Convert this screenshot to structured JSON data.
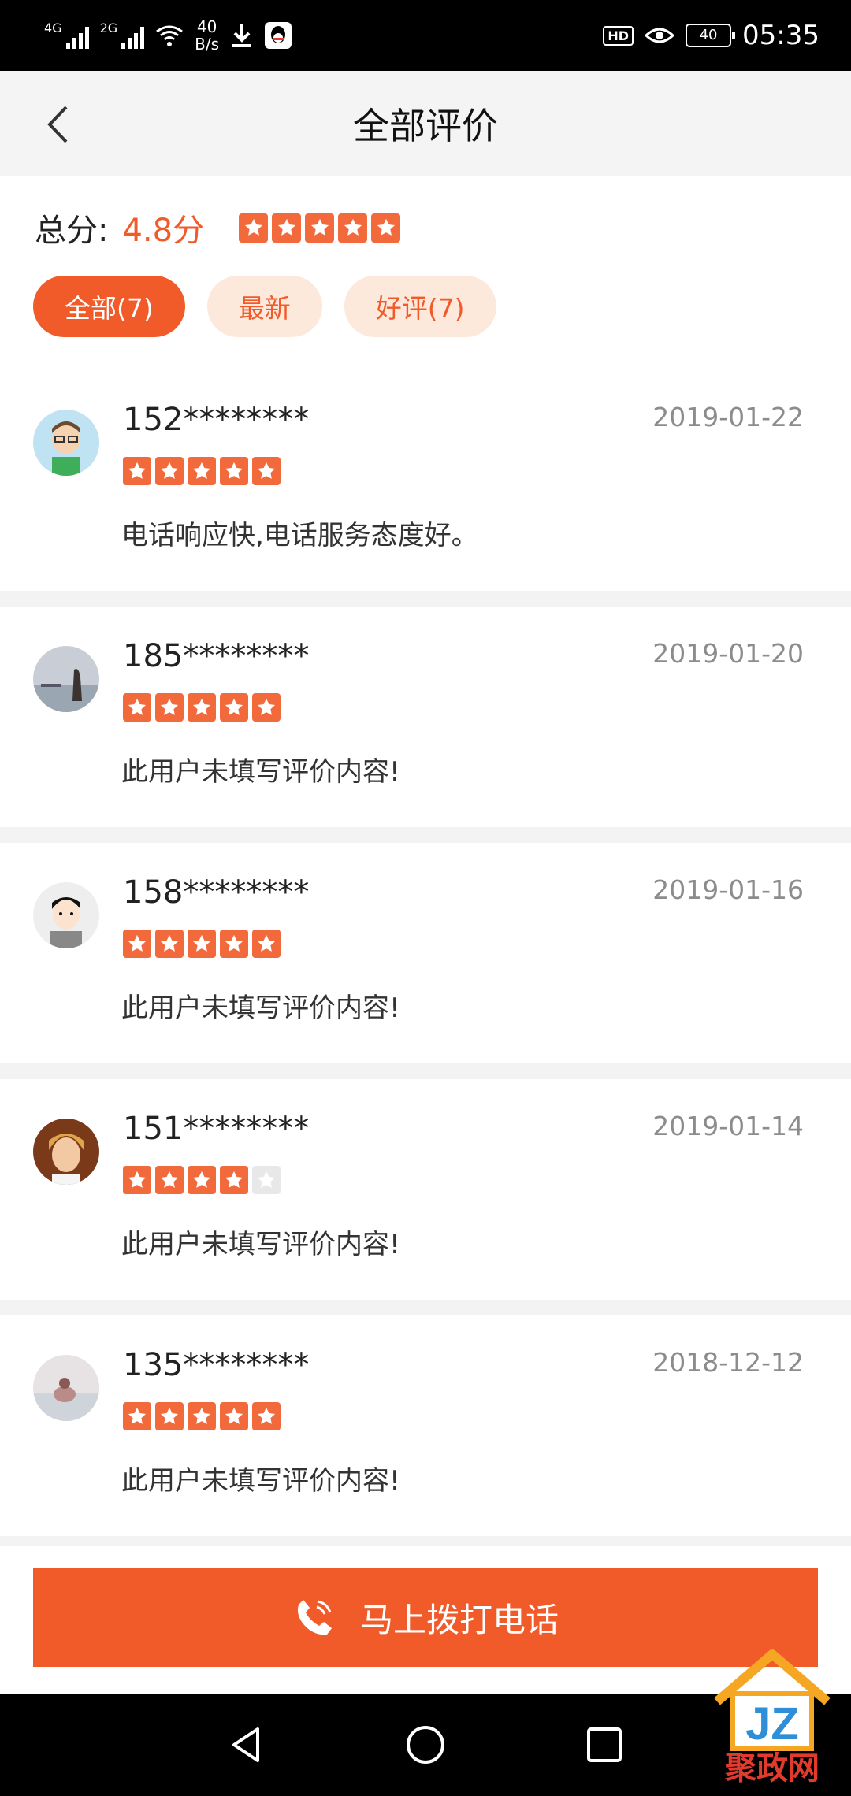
{
  "status_bar": {
    "net1": "4G",
    "net2": "2G",
    "speed_value": "40",
    "speed_unit": "B/s",
    "hd": "HD",
    "battery": "40",
    "time": "05:35"
  },
  "header": {
    "title": "全部评价"
  },
  "score": {
    "label": "总分:",
    "value": "4.8分",
    "stars": 5
  },
  "filters": [
    {
      "label": "全部(7)",
      "active": true
    },
    {
      "label": "最新",
      "active": false
    },
    {
      "label": "好评(7)",
      "active": false
    }
  ],
  "reviews": [
    {
      "user": "152********",
      "date": "2019-01-22",
      "stars": 5,
      "text": "电话响应快,电话服务态度好。"
    },
    {
      "user": "185********",
      "date": "2019-01-20",
      "stars": 5,
      "text": "此用户未填写评价内容!"
    },
    {
      "user": "158********",
      "date": "2019-01-16",
      "stars": 5,
      "text": "此用户未填写评价内容!"
    },
    {
      "user": "151********",
      "date": "2019-01-14",
      "stars": 4,
      "text": "此用户未填写评价内容!"
    },
    {
      "user": "135********",
      "date": "2018-12-12",
      "stars": 5,
      "text": "此用户未填写评价内容!"
    }
  ],
  "call_button": {
    "label": "马上拨打电话"
  },
  "watermark": {
    "text": "聚政网"
  },
  "colors": {
    "accent": "#f15a29",
    "chip_bg": "#fde8dc",
    "star": "#f26a3c",
    "star_off": "#e8e8e8"
  }
}
